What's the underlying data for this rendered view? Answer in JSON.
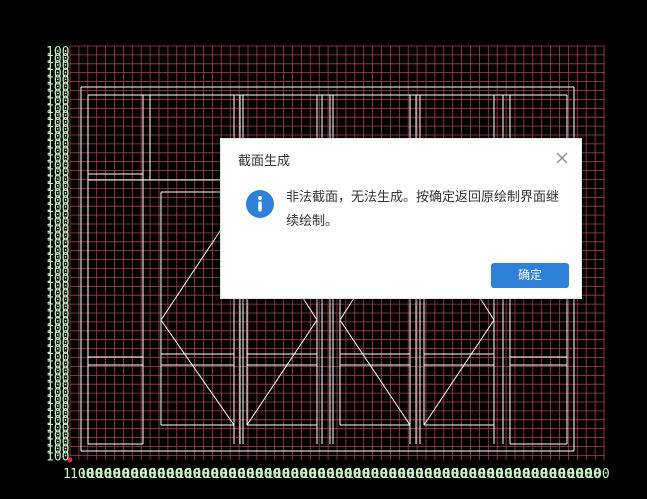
{
  "canvas": {
    "grid_color": "#a84050",
    "drawing_color": "#ffffff",
    "axis_label_color": "#c8f5c8",
    "origin_marker_color": "#e03030",
    "y_axis_label": "100",
    "x_axis_label": "100",
    "x_axis_origin_label": "1"
  },
  "dialog": {
    "title": "截面生成",
    "close_icon": "close-icon",
    "info_icon": "info-icon",
    "message": "非法截面，无法生成。按确定返回原绘制界面继续绘制。",
    "confirm_label": "确定",
    "accent_color": "#2f80d9"
  }
}
